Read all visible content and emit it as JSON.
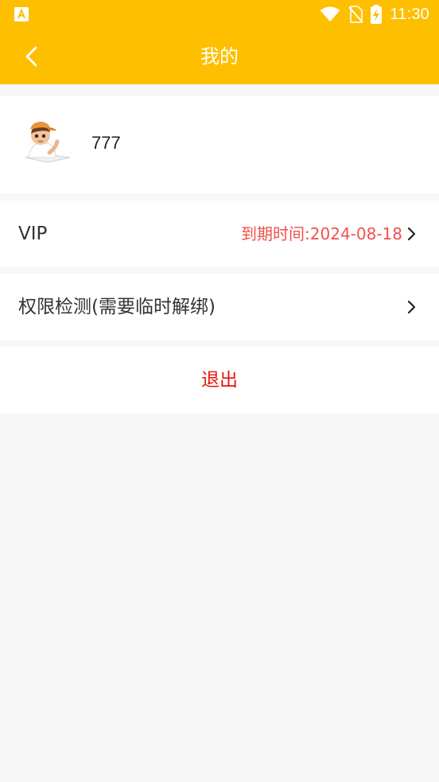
{
  "status_bar": {
    "time": "11:30",
    "left_icon": "app-notification-icon",
    "icons": [
      "wifi-icon",
      "no-sim-icon",
      "battery-charging-icon"
    ]
  },
  "header": {
    "title": "我的",
    "back_icon": "back-arrow-icon"
  },
  "profile": {
    "username": "777",
    "avatar": "avatar"
  },
  "rows": {
    "vip": {
      "label": "VIP",
      "value": "到期时间:2024-08-18"
    },
    "permission": {
      "label": "权限检测(需要临时解绑)"
    }
  },
  "logout": {
    "label": "退出"
  },
  "colors": {
    "accent": "#fdbf00",
    "expiry_text": "#f0514c",
    "logout_text": "#e8140e",
    "background": "#f7f7f7"
  }
}
